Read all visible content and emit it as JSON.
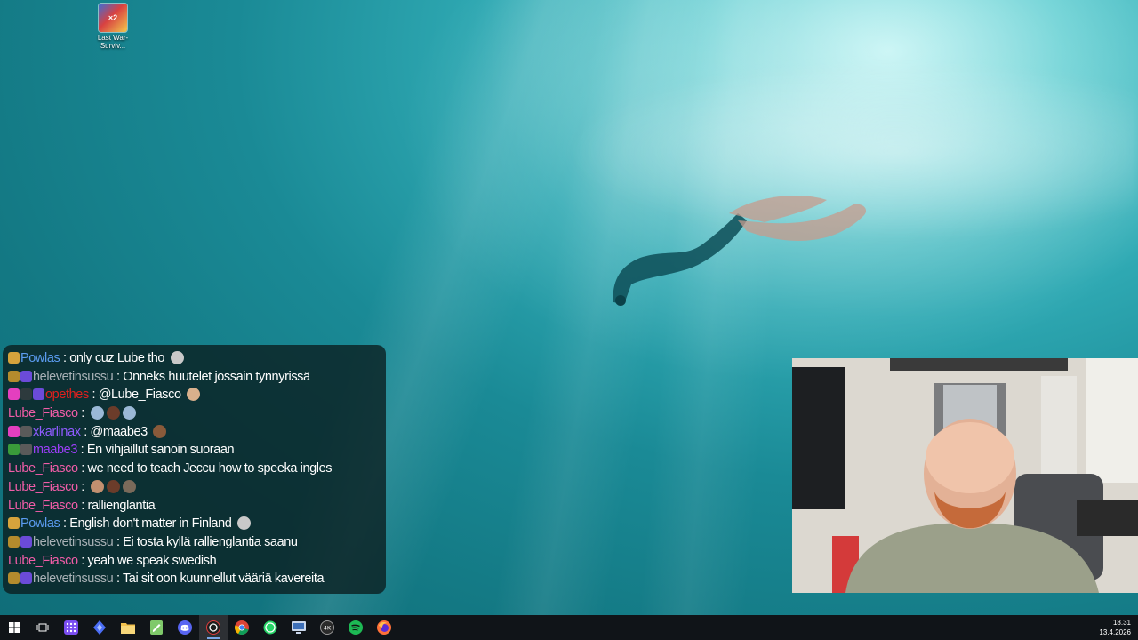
{
  "desktop": {
    "icons": [
      {
        "label": "Last War-Surviv..."
      }
    ]
  },
  "chat": {
    "messages": [
      {
        "user": "Powlas",
        "user_color": "#5b9cf0",
        "text": " : only cuz Lube tho "
      },
      {
        "user": "helevetinsussu",
        "user_color": "#a9b1b6",
        "text": " : Onneks huutelet jossain tynnyrissä"
      },
      {
        "user": "opethes",
        "user_color": "#e0201e",
        "text": " : @Lube_Fiasco "
      },
      {
        "user": "Lube_Fiasco",
        "user_color": "#f25da8",
        "text": " : "
      },
      {
        "user": "xkarlinax",
        "user_color": "#8f5bff",
        "text": " : @maabe3 "
      },
      {
        "user": "maabe3",
        "user_color": "#9b3ef7",
        "text": " : En vihjaillut sanoin suoraan"
      },
      {
        "user": "Lube_Fiasco",
        "user_color": "#f25da8",
        "text": " : we need to teach Jeccu how to speeka ingles"
      },
      {
        "user": "Lube_Fiasco",
        "user_color": "#f25da8",
        "text": " : "
      },
      {
        "user": "Lube_Fiasco",
        "user_color": "#f25da8",
        "text": " : rallienglantia"
      },
      {
        "user": "Powlas",
        "user_color": "#5b9cf0",
        "text": " : English don't matter in Finland "
      },
      {
        "user": "helevetinsussu",
        "user_color": "#a9b1b6",
        "text": " : Ei tosta kyllä rallienglantia saanu"
      },
      {
        "user": "Lube_Fiasco",
        "user_color": "#f25da8",
        "text": " : yeah we speak swedish"
      },
      {
        "user": "helevetinsussu",
        "user_color": "#a9b1b6",
        "text": " : Tai sit oon kuunnellut vääriä kavereita"
      }
    ]
  },
  "taskbar": {
    "items": [
      {
        "name": "start-icon"
      },
      {
        "name": "task-view-icon"
      },
      {
        "name": "app-grid-icon"
      },
      {
        "name": "diamond-app-icon"
      },
      {
        "name": "file-explorer-icon"
      },
      {
        "name": "notepad-icon"
      },
      {
        "name": "discord-icon"
      },
      {
        "name": "obs-icon"
      },
      {
        "name": "chrome-icon"
      },
      {
        "name": "whatsapp-icon"
      },
      {
        "name": "monitor-app-icon"
      },
      {
        "name": "4k-app-icon"
      },
      {
        "name": "spotify-icon"
      },
      {
        "name": "firefox-icon"
      }
    ],
    "time": "18.31",
    "date": "13.4.2026"
  },
  "colors": {
    "water_dark": "#0f6d78",
    "water_light": "#bff3f3",
    "taskbar": "#101418"
  }
}
